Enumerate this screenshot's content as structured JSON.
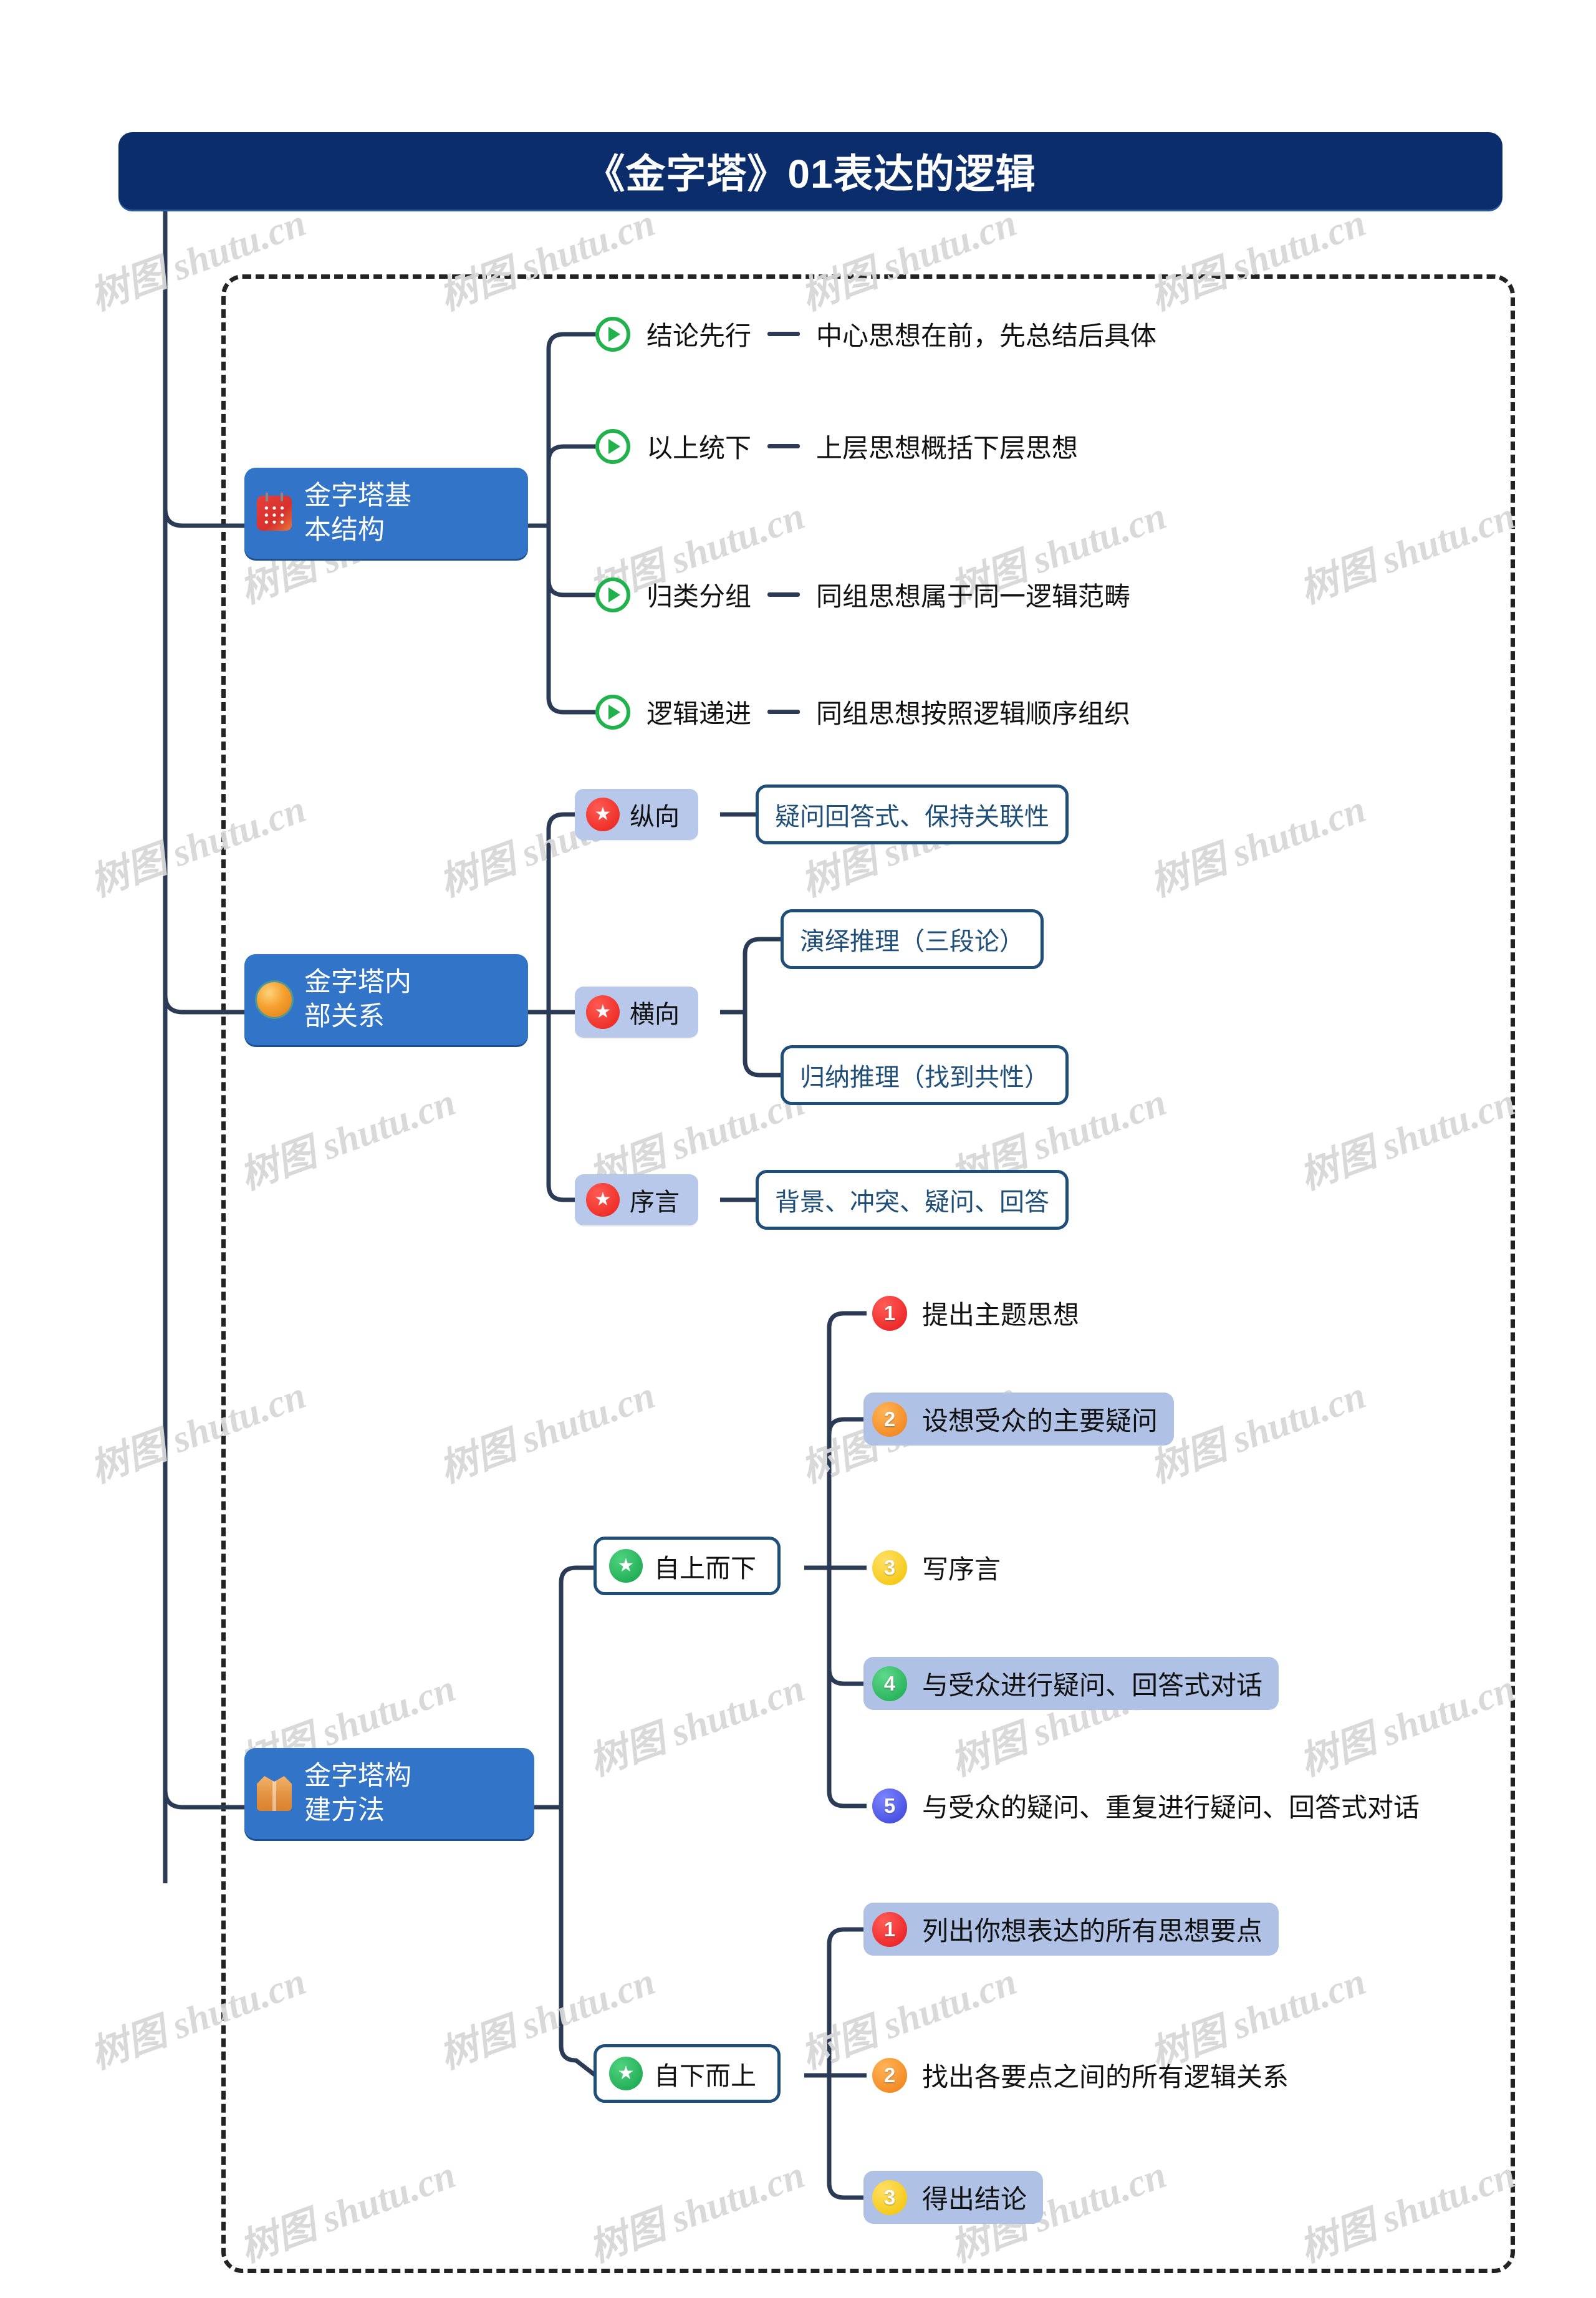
{
  "title": "《金字塔》01表达的逻辑",
  "watermark": "树图 shutu.cn",
  "colors": {
    "title_bg": "#0b2d6b",
    "branch_bg": "#3174c8",
    "connector": "#2b3a55",
    "leaf_border": "#1f4e79",
    "highlight": "#afc1e5",
    "dashed_border": "#232323"
  },
  "branches": [
    {
      "label": "金字塔基本结构",
      "icon": "abacus-icon",
      "items": [
        {
          "icon": "play-icon",
          "term": "结论先行",
          "desc": "中心思想在前，先总结后具体"
        },
        {
          "icon": "play-icon",
          "term": "以上统下",
          "desc": "上层思想概括下层思想"
        },
        {
          "icon": "play-icon",
          "term": "归类分组",
          "desc": "同组思想属于同一逻辑范畴"
        },
        {
          "icon": "play-icon",
          "term": "逻辑递进",
          "desc": "同组思想按照逻辑顺序组织"
        }
      ]
    },
    {
      "label": "金字塔内部关系",
      "icon": "gold-ball-icon",
      "items": [
        {
          "icon": "red-star-icon",
          "label": "纵向",
          "leaves": [
            "疑问回答式、保持关联性"
          ]
        },
        {
          "icon": "red-star-icon",
          "label": "横向",
          "leaves": [
            "演绎推理（三段论）",
            "归纳推理（找到共性）"
          ]
        },
        {
          "icon": "red-star-icon",
          "label": "序言",
          "leaves": [
            "背景、冲突、疑问、回答"
          ]
        }
      ]
    },
    {
      "label": "金字塔构建方法",
      "icon": "package-icon",
      "items": [
        {
          "icon": "green-star-icon",
          "label": "自上而下",
          "steps": [
            {
              "num": "1",
              "color": "red",
              "text": "提出主题思想",
              "highlight": false
            },
            {
              "num": "2",
              "color": "orange",
              "text": "设想受众的主要疑问",
              "highlight": true
            },
            {
              "num": "3",
              "color": "yellow",
              "text": "写序言",
              "highlight": false
            },
            {
              "num": "4",
              "color": "green",
              "text": "与受众进行疑问、回答式对话",
              "highlight": true
            },
            {
              "num": "5",
              "color": "blue",
              "text": "与受众的疑问、重复进行疑问、回答式对话",
              "highlight": false
            }
          ]
        },
        {
          "icon": "green-star-icon",
          "label": "自下而上",
          "steps": [
            {
              "num": "1",
              "color": "red",
              "text": "列出你想表达的所有思想要点",
              "highlight": true
            },
            {
              "num": "2",
              "color": "orange",
              "text": "找出各要点之间的所有逻辑关系",
              "highlight": false
            },
            {
              "num": "3",
              "color": "yellow",
              "text": "得出结论",
              "highlight": true
            }
          ]
        }
      ]
    }
  ]
}
